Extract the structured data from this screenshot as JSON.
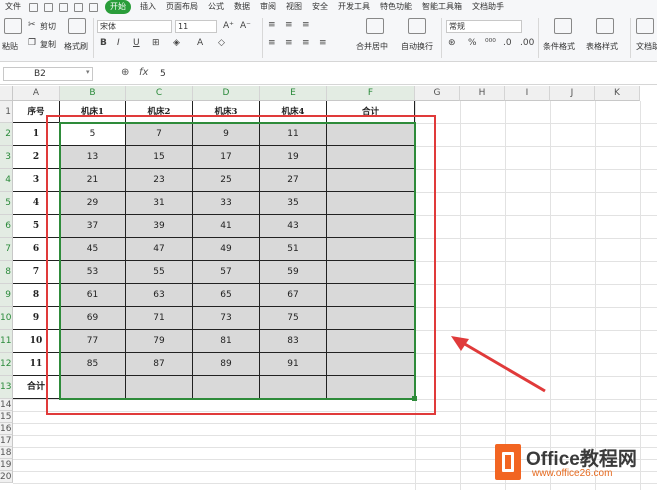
{
  "menu": {
    "file": "文件",
    "tabs": [
      "开始",
      "插入",
      "页面布局",
      "公式",
      "数据",
      "审阅",
      "视图",
      "安全",
      "开发工具",
      "特色功能",
      "智能工具箱",
      "文档助手"
    ]
  },
  "ribbon": {
    "paste": "粘贴",
    "cut": "剪切",
    "copy": "复制",
    "format_painter": "格式刷",
    "font_name": "宋体",
    "font_size": "11",
    "merge_center": "合并居中",
    "wrap_text": "自动换行",
    "number_format": "常规",
    "conditional_format": "条件格式",
    "table_style": "表格样式",
    "doc_help": "文档助"
  },
  "formula_bar": {
    "name_box": "B2",
    "fx": "fx",
    "value": "5"
  },
  "sheet": {
    "columns": [
      "A",
      "B",
      "C",
      "D",
      "E",
      "F",
      "G",
      "H",
      "I",
      "J",
      "K"
    ],
    "rows": [
      "1",
      "2",
      "3",
      "4",
      "5",
      "6",
      "7",
      "8",
      "9",
      "10",
      "11",
      "12",
      "13",
      "14",
      "15",
      "16",
      "17",
      "18",
      "19",
      "20"
    ],
    "header": [
      "序号",
      "机床1",
      "机床2",
      "机床3",
      "机床4",
      "合计"
    ],
    "data": [
      [
        "1",
        "5",
        "7",
        "9",
        "11",
        ""
      ],
      [
        "2",
        "13",
        "15",
        "17",
        "19",
        ""
      ],
      [
        "3",
        "21",
        "23",
        "25",
        "27",
        ""
      ],
      [
        "4",
        "29",
        "31",
        "33",
        "35",
        ""
      ],
      [
        "5",
        "37",
        "39",
        "41",
        "43",
        ""
      ],
      [
        "6",
        "45",
        "47",
        "49",
        "51",
        ""
      ],
      [
        "7",
        "53",
        "55",
        "57",
        "59",
        ""
      ],
      [
        "8",
        "61",
        "63",
        "65",
        "67",
        ""
      ],
      [
        "9",
        "69",
        "71",
        "73",
        "75",
        ""
      ],
      [
        "10",
        "77",
        "79",
        "81",
        "83",
        ""
      ],
      [
        "11",
        "85",
        "87",
        "89",
        "91",
        ""
      ]
    ],
    "total_label": "合计"
  },
  "watermark": {
    "brand": "Office教程网",
    "url": "www.office26.com"
  },
  "colors": {
    "accent": "#2a9d3a",
    "annotation": "#e03a3a",
    "selection": "#2e8b3a",
    "cell_fill": "#d9d9d9"
  }
}
